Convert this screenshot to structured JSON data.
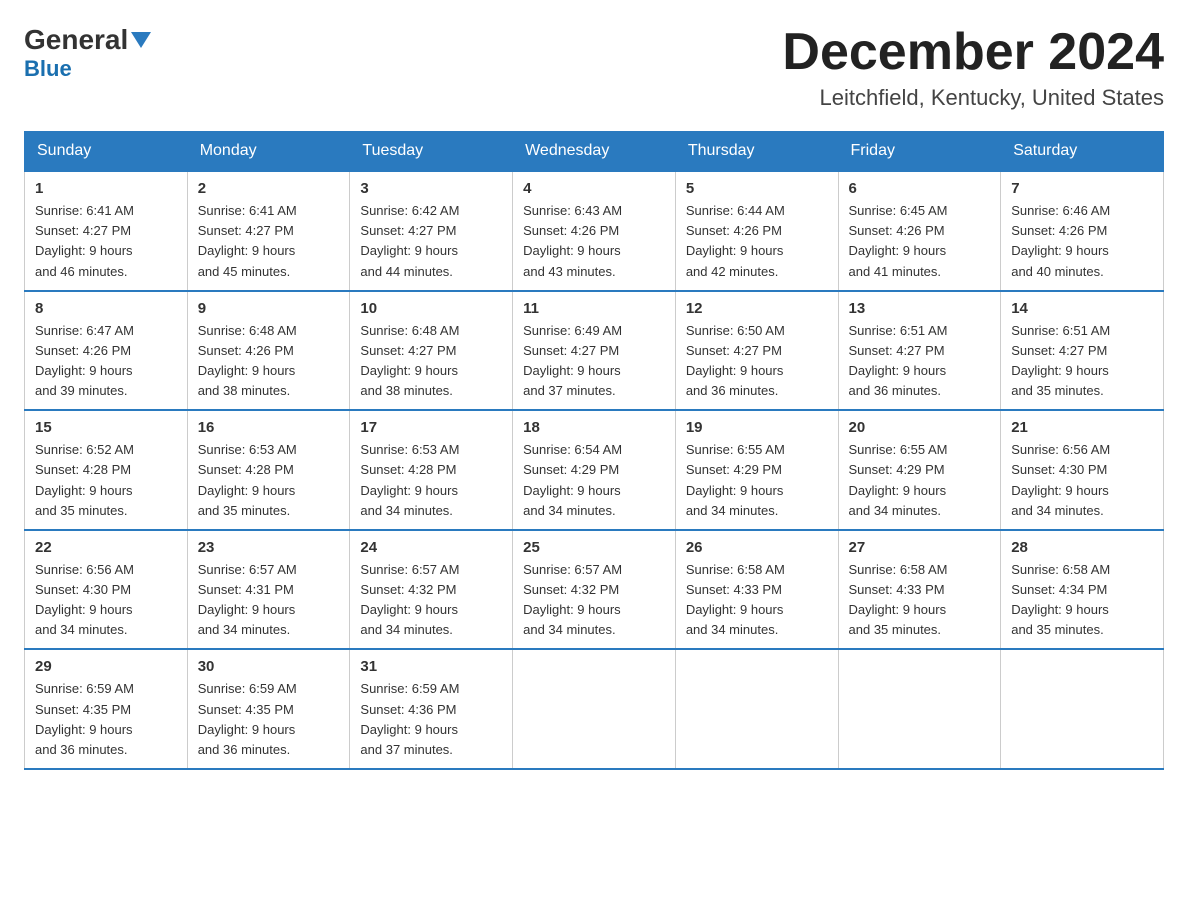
{
  "header": {
    "logo_general": "General",
    "logo_blue": "Blue",
    "month_title": "December 2024",
    "location": "Leitchfield, Kentucky, United States"
  },
  "days_of_week": [
    "Sunday",
    "Monday",
    "Tuesday",
    "Wednesday",
    "Thursday",
    "Friday",
    "Saturday"
  ],
  "weeks": [
    [
      {
        "day": "1",
        "sunrise": "6:41 AM",
        "sunset": "4:27 PM",
        "daylight": "9 hours and 46 minutes."
      },
      {
        "day": "2",
        "sunrise": "6:41 AM",
        "sunset": "4:27 PM",
        "daylight": "9 hours and 45 minutes."
      },
      {
        "day": "3",
        "sunrise": "6:42 AM",
        "sunset": "4:27 PM",
        "daylight": "9 hours and 44 minutes."
      },
      {
        "day": "4",
        "sunrise": "6:43 AM",
        "sunset": "4:26 PM",
        "daylight": "9 hours and 43 minutes."
      },
      {
        "day": "5",
        "sunrise": "6:44 AM",
        "sunset": "4:26 PM",
        "daylight": "9 hours and 42 minutes."
      },
      {
        "day": "6",
        "sunrise": "6:45 AM",
        "sunset": "4:26 PM",
        "daylight": "9 hours and 41 minutes."
      },
      {
        "day": "7",
        "sunrise": "6:46 AM",
        "sunset": "4:26 PM",
        "daylight": "9 hours and 40 minutes."
      }
    ],
    [
      {
        "day": "8",
        "sunrise": "6:47 AM",
        "sunset": "4:26 PM",
        "daylight": "9 hours and 39 minutes."
      },
      {
        "day": "9",
        "sunrise": "6:48 AM",
        "sunset": "4:26 PM",
        "daylight": "9 hours and 38 minutes."
      },
      {
        "day": "10",
        "sunrise": "6:48 AM",
        "sunset": "4:27 PM",
        "daylight": "9 hours and 38 minutes."
      },
      {
        "day": "11",
        "sunrise": "6:49 AM",
        "sunset": "4:27 PM",
        "daylight": "9 hours and 37 minutes."
      },
      {
        "day": "12",
        "sunrise": "6:50 AM",
        "sunset": "4:27 PM",
        "daylight": "9 hours and 36 minutes."
      },
      {
        "day": "13",
        "sunrise": "6:51 AM",
        "sunset": "4:27 PM",
        "daylight": "9 hours and 36 minutes."
      },
      {
        "day": "14",
        "sunrise": "6:51 AM",
        "sunset": "4:27 PM",
        "daylight": "9 hours and 35 minutes."
      }
    ],
    [
      {
        "day": "15",
        "sunrise": "6:52 AM",
        "sunset": "4:28 PM",
        "daylight": "9 hours and 35 minutes."
      },
      {
        "day": "16",
        "sunrise": "6:53 AM",
        "sunset": "4:28 PM",
        "daylight": "9 hours and 35 minutes."
      },
      {
        "day": "17",
        "sunrise": "6:53 AM",
        "sunset": "4:28 PM",
        "daylight": "9 hours and 34 minutes."
      },
      {
        "day": "18",
        "sunrise": "6:54 AM",
        "sunset": "4:29 PM",
        "daylight": "9 hours and 34 minutes."
      },
      {
        "day": "19",
        "sunrise": "6:55 AM",
        "sunset": "4:29 PM",
        "daylight": "9 hours and 34 minutes."
      },
      {
        "day": "20",
        "sunrise": "6:55 AM",
        "sunset": "4:29 PM",
        "daylight": "9 hours and 34 minutes."
      },
      {
        "day": "21",
        "sunrise": "6:56 AM",
        "sunset": "4:30 PM",
        "daylight": "9 hours and 34 minutes."
      }
    ],
    [
      {
        "day": "22",
        "sunrise": "6:56 AM",
        "sunset": "4:30 PM",
        "daylight": "9 hours and 34 minutes."
      },
      {
        "day": "23",
        "sunrise": "6:57 AM",
        "sunset": "4:31 PM",
        "daylight": "9 hours and 34 minutes."
      },
      {
        "day": "24",
        "sunrise": "6:57 AM",
        "sunset": "4:32 PM",
        "daylight": "9 hours and 34 minutes."
      },
      {
        "day": "25",
        "sunrise": "6:57 AM",
        "sunset": "4:32 PM",
        "daylight": "9 hours and 34 minutes."
      },
      {
        "day": "26",
        "sunrise": "6:58 AM",
        "sunset": "4:33 PM",
        "daylight": "9 hours and 34 minutes."
      },
      {
        "day": "27",
        "sunrise": "6:58 AM",
        "sunset": "4:33 PM",
        "daylight": "9 hours and 35 minutes."
      },
      {
        "day": "28",
        "sunrise": "6:58 AM",
        "sunset": "4:34 PM",
        "daylight": "9 hours and 35 minutes."
      }
    ],
    [
      {
        "day": "29",
        "sunrise": "6:59 AM",
        "sunset": "4:35 PM",
        "daylight": "9 hours and 36 minutes."
      },
      {
        "day": "30",
        "sunrise": "6:59 AM",
        "sunset": "4:35 PM",
        "daylight": "9 hours and 36 minutes."
      },
      {
        "day": "31",
        "sunrise": "6:59 AM",
        "sunset": "4:36 PM",
        "daylight": "9 hours and 37 minutes."
      },
      null,
      null,
      null,
      null
    ]
  ],
  "labels": {
    "sunrise": "Sunrise:",
    "sunset": "Sunset:",
    "daylight": "Daylight:"
  }
}
